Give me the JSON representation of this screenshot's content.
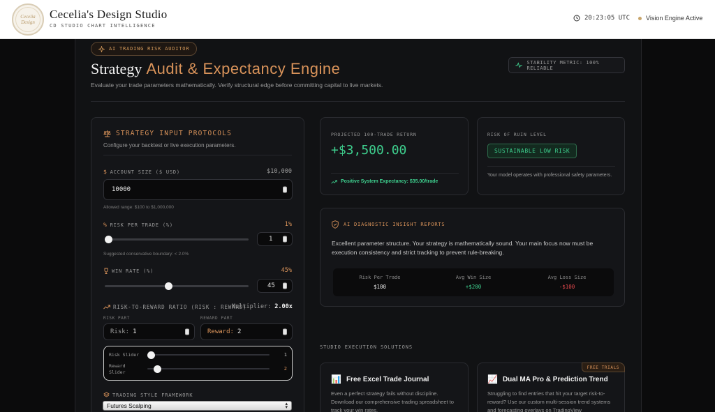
{
  "header": {
    "logo_text": "Cecelia's Design Studio",
    "brand_title": "Cecelia's Design Studio",
    "brand_subtitle": "CD STUDIO CHART INTELLIGENCE",
    "time": "20:23:05 UTC",
    "status": "Vision Engine Active"
  },
  "hero": {
    "badge": "AI TRADING RISK AUDITOR",
    "title_part1": "Strategy",
    "title_part2": "Audit & Expectancy Engine",
    "subtitle": "Evaluate your trade parameters mathematically. Verify structural edge before committing capital to live markets.",
    "stability": "STABILITY METRIC: 100% RELIABLE"
  },
  "inputs": {
    "title": "STRATEGY INPUT PROTOCOLS",
    "subtitle": "Configure your backtest or live execution parameters.",
    "account": {
      "label": "ACCOUNT SIZE ($ USD)",
      "display": "$10,000",
      "value": "10000",
      "hint": "Allowed range: $100 to $1,000,000"
    },
    "risk": {
      "label": "RISK PER TRADE (%)",
      "display": "1%",
      "value": "1",
      "hint": "Suggested conservative boundary: < 2.0%",
      "level": 0.0
    },
    "winrate": {
      "label": "WIN RATE (%)",
      "display": "45%",
      "value": "45",
      "level": 0.44
    },
    "rr": {
      "label": "RISK-TO-REWARD RATIO (RISK : REWARD)",
      "multiplier_label": "Multiplier:",
      "multiplier_value": "2.00x",
      "risk_part_label": "RISK PART",
      "reward_part_label": "REWARD PART",
      "risk_prefix": "Risk:",
      "risk_value": "1",
      "reward_prefix": "Reward:",
      "reward_value": "2",
      "risk_slider_label": "Risk Slider",
      "risk_slider_value": "1",
      "reward_slider_label": "Reward Slider",
      "reward_slider_value": "2",
      "risk_slider_level": 0.0,
      "reward_slider_level": 0.06
    },
    "style": {
      "label": "TRADING STYLE FRAMEWORK",
      "selected": "Futures Scalping"
    }
  },
  "projection": {
    "label": "PROJECTED 100-TRADE RETURN",
    "value": "+$3,500.00",
    "note": "Positive System Expectancy: $35.00/trade"
  },
  "ruin": {
    "label": "RISK OF RUIN LEVEL",
    "badge": "SUSTAINABLE LOW RISK",
    "note": "Your model operates with professional safety parameters."
  },
  "diagnostic": {
    "title": "AI DIAGNOSTIC INSIGHT REPORTS",
    "text": "Excellent parameter structure. Your strategy is mathematically sound. Your main focus now must be execution consistency and strict tracking to prevent rule-breaking.",
    "stats": [
      {
        "label": "Risk Per Trade",
        "value": "$100"
      },
      {
        "label": "Avg Win Size",
        "value": "+$200"
      },
      {
        "label": "Avg Loss Size",
        "value": "-$100"
      }
    ]
  },
  "solutions": {
    "heading": "STUDIO EXECUTION SOLUTIONS",
    "items": [
      {
        "icon": "📊",
        "title": "Free Excel Trade Journal",
        "text": "Even a perfect strategy fails without discipline. Download our comprehensive trading spreadsheet to track your win rates."
      },
      {
        "icon": "📈",
        "title": "Dual MA Pro & Prediction Trend",
        "badge": "FREE TRIALS",
        "text": "Struggling to find entries that hit your target risk-to-reward? Use our custom multi-session trend systems and forecasting overlays on TradingView"
      }
    ]
  },
  "colors": {
    "accent": "#d9935a",
    "positive": "#3ecf8e",
    "negative": "#e5484d",
    "background": "#111214"
  }
}
